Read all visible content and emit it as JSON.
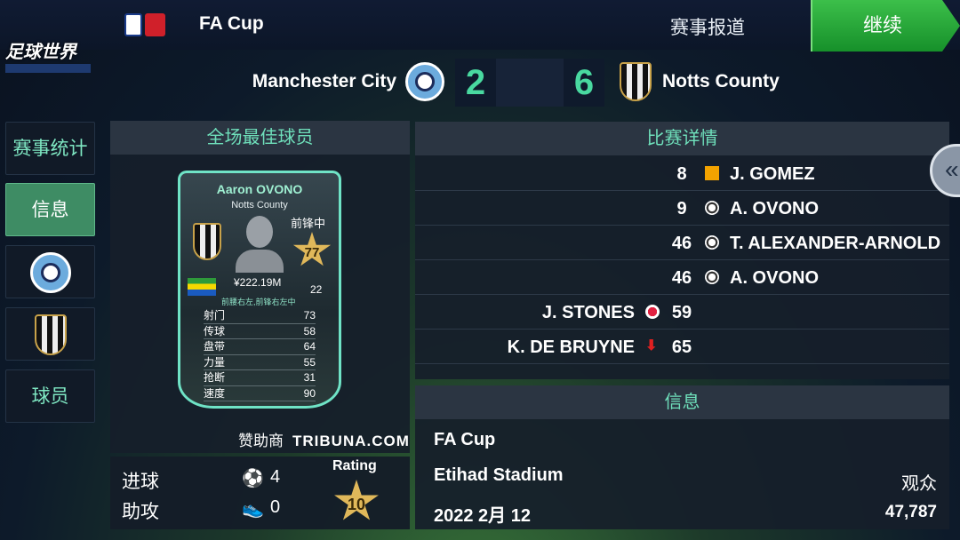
{
  "header": {
    "competition": "FA Cup",
    "report_link": "赛事报道",
    "continue_label": "继续"
  },
  "game_logo": "足球世界",
  "match": {
    "home_team": "Manchester City",
    "away_team": "Notts County",
    "home_score": "2",
    "away_score": "6"
  },
  "sidebar": {
    "items": [
      {
        "label": "赛事统计"
      },
      {
        "label": "信息"
      },
      {
        "label": "",
        "icon": "manchester-city-crest"
      },
      {
        "label": "",
        "icon": "notts-county-crest"
      },
      {
        "label": "球员"
      }
    ]
  },
  "mvp": {
    "title": "全场最佳球员",
    "name": "Aaron OVONO",
    "club": "Notts County",
    "position": "前锋中",
    "rating": "77",
    "value": "¥222.19M",
    "age": "22",
    "alt_positions": "前腰右左,前锋右左中",
    "flag": "gabon-flag",
    "stats": [
      {
        "label": "射门",
        "value": "73"
      },
      {
        "label": "传球",
        "value": "58"
      },
      {
        "label": "盘带",
        "value": "64"
      },
      {
        "label": "力量",
        "value": "55"
      },
      {
        "label": "抢断",
        "value": "31"
      },
      {
        "label": "速度",
        "value": "90"
      }
    ],
    "sponsor_label": "赞助商",
    "sponsor_name": "TRIBUNA.COM"
  },
  "summary": {
    "goals_label": "进球",
    "goals": "4",
    "assists_label": "助攻",
    "assists": "0",
    "rating_label": "Rating",
    "rating": "10"
  },
  "details": {
    "title": "比赛详情",
    "events": [
      {
        "side": "away",
        "minute": "8",
        "type": "yellow-card",
        "player": "J. GOMEZ"
      },
      {
        "side": "away",
        "minute": "9",
        "type": "goal",
        "player": "A. OVONO"
      },
      {
        "side": "away",
        "minute": "46",
        "type": "goal",
        "player": "T. ALEXANDER-ARNOLD"
      },
      {
        "side": "away",
        "minute": "46",
        "type": "goal",
        "player": "A. OVONO"
      },
      {
        "side": "home",
        "minute": "59",
        "type": "injury",
        "player": "J. STONES"
      },
      {
        "side": "home",
        "minute": "65",
        "type": "sub-off",
        "player": "K. DE BRUYNE"
      }
    ]
  },
  "info": {
    "title": "信息",
    "competition": "FA Cup",
    "stadium": "Etihad Stadium",
    "date": "2022 2月 12",
    "crowd_label": "观众",
    "crowd": "47,787"
  },
  "colors": {
    "accent": "#6fe0bb",
    "continue": "#1ea834",
    "score": "#49d9a0",
    "star": "#e0b85a"
  }
}
